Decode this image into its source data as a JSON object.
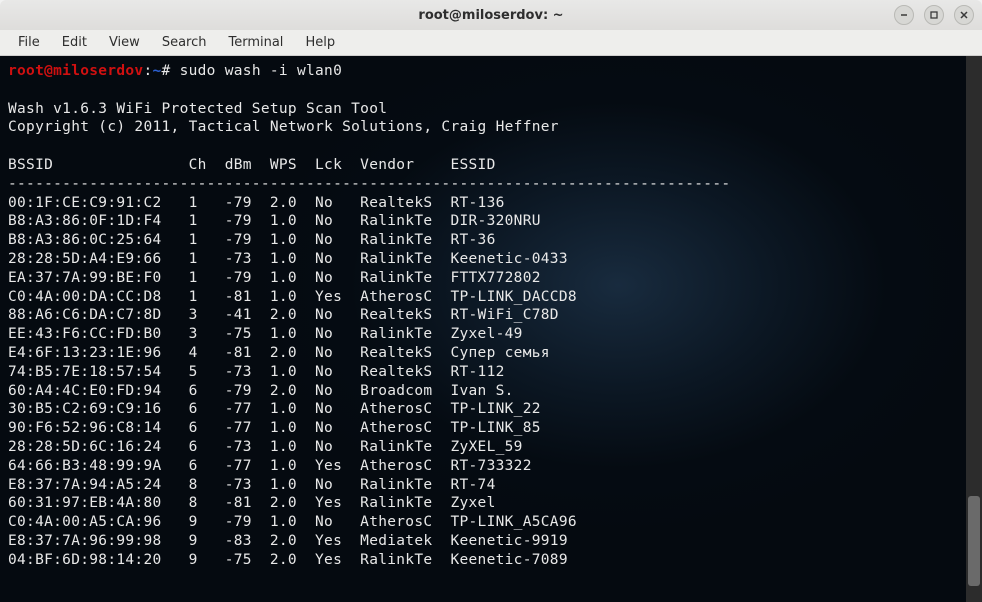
{
  "window": {
    "title": "root@miloserdov: ~"
  },
  "menubar": {
    "file": "File",
    "edit": "Edit",
    "view": "View",
    "search": "Search",
    "terminal": "Terminal",
    "help": "Help"
  },
  "prompt": {
    "userhost": "root@miloserdov",
    "colon": ":",
    "path": "~",
    "hash": "#",
    "command": " sudo wash -i wlan0"
  },
  "output": {
    "line_blank1": "",
    "line_tool": "Wash v1.6.3 WiFi Protected Setup Scan Tool",
    "line_copyright": "Copyright (c) 2011, Tactical Network Solutions, Craig Heffner",
    "line_blank2": "",
    "line_header": "BSSID               Ch  dBm  WPS  Lck  Vendor    ESSID",
    "line_divider": "--------------------------------------------------------------------------------"
  },
  "chart_data": {
    "type": "table",
    "columns": [
      "BSSID",
      "Ch",
      "dBm",
      "WPS",
      "Lck",
      "Vendor",
      "ESSID"
    ],
    "rows": [
      {
        "bssid": "00:1F:CE:C9:91:C2",
        "ch": 1,
        "dbm": -79,
        "wps": "2.0",
        "lck": "No",
        "vendor": "RealtekS",
        "essid": "RT-136"
      },
      {
        "bssid": "B8:A3:86:0F:1D:F4",
        "ch": 1,
        "dbm": -79,
        "wps": "1.0",
        "lck": "No",
        "vendor": "RalinkTe",
        "essid": "DIR-320NRU"
      },
      {
        "bssid": "B8:A3:86:0C:25:64",
        "ch": 1,
        "dbm": -79,
        "wps": "1.0",
        "lck": "No",
        "vendor": "RalinkTe",
        "essid": "RT-36"
      },
      {
        "bssid": "28:28:5D:A4:E9:66",
        "ch": 1,
        "dbm": -73,
        "wps": "1.0",
        "lck": "No",
        "vendor": "RalinkTe",
        "essid": "Keenetic-0433"
      },
      {
        "bssid": "EA:37:7A:99:BE:F0",
        "ch": 1,
        "dbm": -79,
        "wps": "1.0",
        "lck": "No",
        "vendor": "RalinkTe",
        "essid": "FTTX772802"
      },
      {
        "bssid": "C0:4A:00:DA:CC:D8",
        "ch": 1,
        "dbm": -81,
        "wps": "1.0",
        "lck": "Yes",
        "vendor": "AtherosC",
        "essid": "TP-LINK_DACCD8"
      },
      {
        "bssid": "88:A6:C6:DA:C7:8D",
        "ch": 3,
        "dbm": -41,
        "wps": "2.0",
        "lck": "No",
        "vendor": "RealtekS",
        "essid": "RT-WiFi_C78D"
      },
      {
        "bssid": "EE:43:F6:CC:FD:B0",
        "ch": 3,
        "dbm": -75,
        "wps": "1.0",
        "lck": "No",
        "vendor": "RalinkTe",
        "essid": "Zyxel-49"
      },
      {
        "bssid": "E4:6F:13:23:1E:96",
        "ch": 4,
        "dbm": -81,
        "wps": "2.0",
        "lck": "No",
        "vendor": "RealtekS",
        "essid": "Супер семья"
      },
      {
        "bssid": "74:B5:7E:18:57:54",
        "ch": 5,
        "dbm": -73,
        "wps": "1.0",
        "lck": "No",
        "vendor": "RealtekS",
        "essid": "RT-112"
      },
      {
        "bssid": "60:A4:4C:E0:FD:94",
        "ch": 6,
        "dbm": -79,
        "wps": "2.0",
        "lck": "No",
        "vendor": "Broadcom",
        "essid": "Ivan S."
      },
      {
        "bssid": "30:B5:C2:69:C9:16",
        "ch": 6,
        "dbm": -77,
        "wps": "1.0",
        "lck": "No",
        "vendor": "AtherosC",
        "essid": "TP-LINK_22"
      },
      {
        "bssid": "90:F6:52:96:C8:14",
        "ch": 6,
        "dbm": -77,
        "wps": "1.0",
        "lck": "No",
        "vendor": "AtherosC",
        "essid": "TP-LINK_85"
      },
      {
        "bssid": "28:28:5D:6C:16:24",
        "ch": 6,
        "dbm": -73,
        "wps": "1.0",
        "lck": "No",
        "vendor": "RalinkTe",
        "essid": "ZyXEL_59"
      },
      {
        "bssid": "64:66:B3:48:99:9A",
        "ch": 6,
        "dbm": -77,
        "wps": "1.0",
        "lck": "Yes",
        "vendor": "AtherosC",
        "essid": "RT-733322"
      },
      {
        "bssid": "E8:37:7A:94:A5:24",
        "ch": 8,
        "dbm": -73,
        "wps": "1.0",
        "lck": "No",
        "vendor": "RalinkTe",
        "essid": "RT-74"
      },
      {
        "bssid": "60:31:97:EB:4A:80",
        "ch": 8,
        "dbm": -81,
        "wps": "2.0",
        "lck": "Yes",
        "vendor": "RalinkTe",
        "essid": "Zyxel"
      },
      {
        "bssid": "C0:4A:00:A5:CA:96",
        "ch": 9,
        "dbm": -79,
        "wps": "1.0",
        "lck": "No",
        "vendor": "AtherosC",
        "essid": "TP-LINK_A5CA96"
      },
      {
        "bssid": "E8:37:7A:96:99:98",
        "ch": 9,
        "dbm": -83,
        "wps": "2.0",
        "lck": "Yes",
        "vendor": "Mediatek",
        "essid": "Keenetic-9919"
      },
      {
        "bssid": "04:BF:6D:98:14:20",
        "ch": 9,
        "dbm": -75,
        "wps": "2.0",
        "lck": "Yes",
        "vendor": "RalinkTe",
        "essid": "Keenetic-7089"
      }
    ]
  }
}
